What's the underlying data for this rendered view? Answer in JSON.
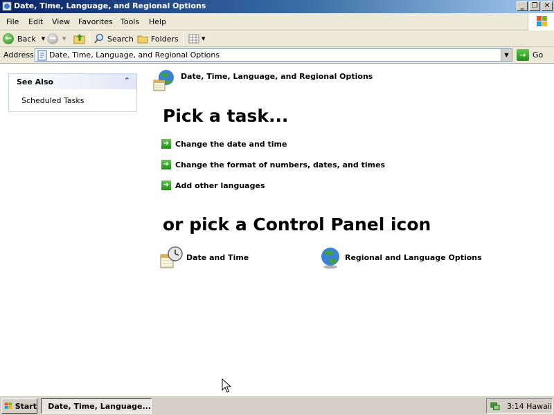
{
  "window": {
    "title": "Date, Time, Language, and Regional Options"
  },
  "menu": {
    "items": [
      "File",
      "Edit",
      "View",
      "Favorites",
      "Tools",
      "Help"
    ]
  },
  "toolbar": {
    "back_label": "Back",
    "search_label": "Search",
    "folders_label": "Folders"
  },
  "address": {
    "label": "Address",
    "value": "Date, Time, Language, and Regional Options",
    "go_label": "Go"
  },
  "sidebar": {
    "header": "See Also",
    "links": [
      "Scheduled Tasks"
    ]
  },
  "main": {
    "category_title": "Date, Time, Language, and Regional Options",
    "task_heading": "Pick a task...",
    "tasks": [
      "Change the date and time",
      "Change the format of numbers, dates, and times",
      "Add other languages"
    ],
    "icon_heading": "or pick a Control Panel icon",
    "icons": [
      {
        "label": "Date and Time",
        "icon": "date-time-icon"
      },
      {
        "label": "Regional and Language Options",
        "icon": "globe-icon"
      }
    ]
  },
  "taskbar": {
    "start_label": "Start",
    "task_label": "Date, Time, Language...",
    "clock": "3:14 Hawaii"
  },
  "colors": {
    "title_gradient_start": "#0a246a",
    "title_gradient_end": "#a6caf0",
    "chrome": "#ece9d8",
    "task_arrow": "#2f9a22"
  }
}
